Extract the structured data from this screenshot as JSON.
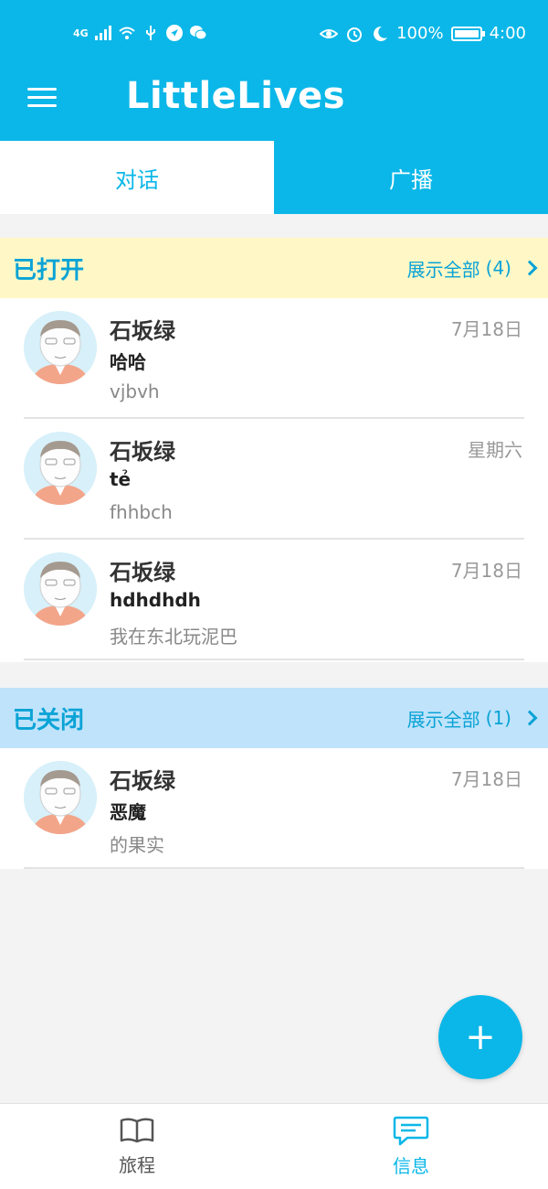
{
  "status_bar": {
    "left_text": "4G",
    "battery": "100%",
    "time": "4:00"
  },
  "app": {
    "title": "LittleLives",
    "accent_color": "#0bb7e8"
  },
  "tabs": [
    {
      "label": "对话",
      "active": true
    },
    {
      "label": "广播",
      "active": false
    }
  ],
  "sections": {
    "open": {
      "title": "已打开",
      "show_all": "展示全部",
      "count": "(4)",
      "conversations": [
        {
          "name": "石坂绿",
          "subject": "哈哈",
          "preview": "vjbvh",
          "date": "7月18日"
        },
        {
          "name": "石坂绿",
          "subject": "tẻ",
          "preview": "fhhbch",
          "date": "星期六"
        },
        {
          "name": "石坂绿",
          "subject": "hdhdhdh",
          "preview": "我在东北玩泥巴",
          "date": "7月18日"
        }
      ]
    },
    "closed": {
      "title": "已关闭",
      "show_all": "展示全部",
      "count": "(1)",
      "conversations": [
        {
          "name": "石坂绿",
          "subject": "恶魔",
          "preview": "的果实",
          "date": "7月18日"
        }
      ]
    }
  },
  "bottom_nav": [
    {
      "label": "旅程",
      "icon": "book-icon",
      "active": false
    },
    {
      "label": "信息",
      "icon": "message-icon",
      "active": true
    }
  ]
}
